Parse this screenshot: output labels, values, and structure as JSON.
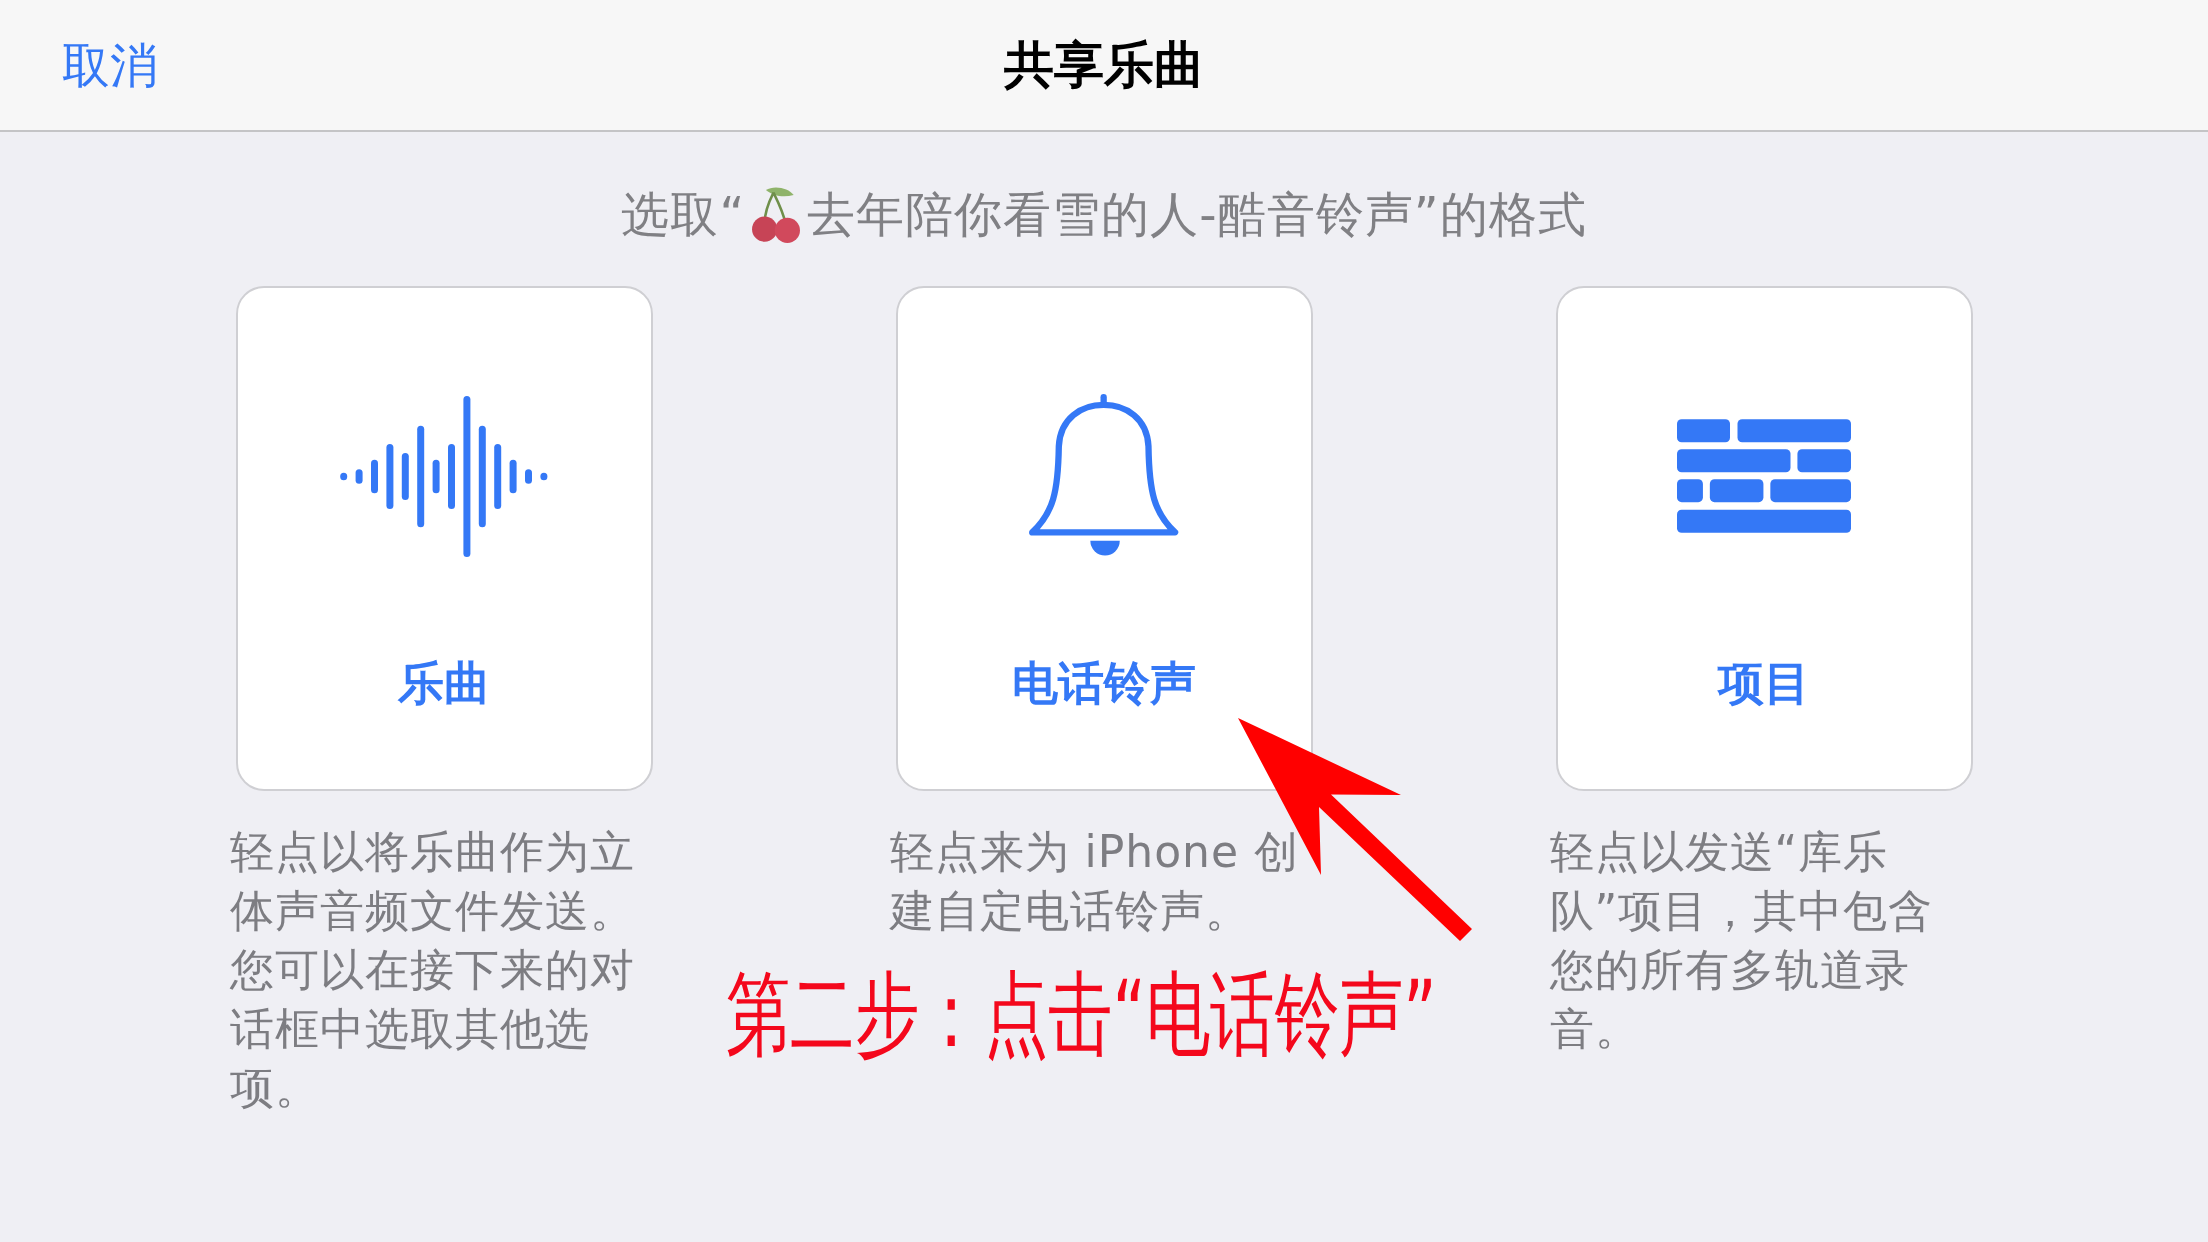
{
  "nav_bar": {
    "cancel": "取消",
    "title": "共享乐曲"
  },
  "prompt": {
    "before_icon": "选取“",
    "after_icon": "去年陪你看雪的人-酷音铃声”的格式"
  },
  "options": [
    {
      "kind": "waveform",
      "label": "乐曲",
      "description": "轻点以将乐曲作为立体声音频文件发送。您可以在接下来的对话框中选取其他选项。"
    },
    {
      "kind": "bell",
      "label": "电话铃声",
      "description": "轻点来为 iPhone 创建自定电话铃声。"
    },
    {
      "kind": "bricks",
      "label": "项目",
      "description": "轻点以发送“库乐队”项目，其中包含您的所有多轨道录音。"
    }
  ],
  "annotation": {
    "text": "第二步：点击“电话铃声”"
  }
}
